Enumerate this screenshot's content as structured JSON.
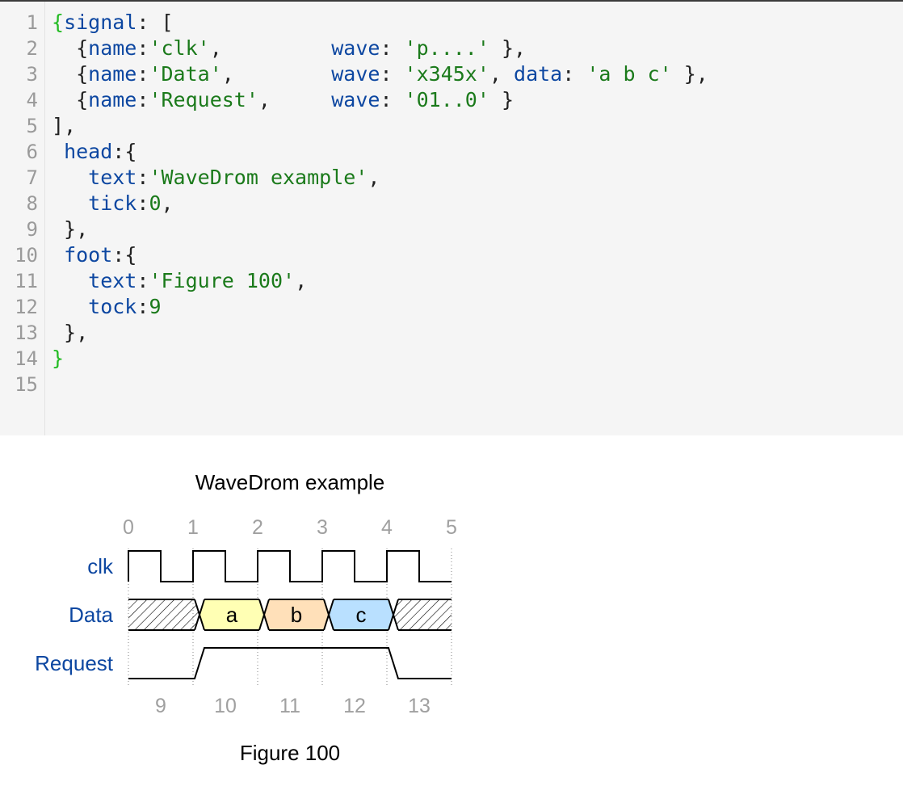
{
  "editor": {
    "colors": {
      "property": "#0d47a1",
      "string": "#1b7a1b",
      "number": "#1b7a1b",
      "bracket_match": "#22bb22",
      "punct": "#222222",
      "gutter": "#9a9a9a"
    },
    "lines": [
      {
        "n": "1",
        "tokens": [
          {
            "t": "{",
            "c": "bracket_match"
          },
          {
            "t": "signal",
            "c": "property"
          },
          {
            "t": ": [",
            "c": "punct"
          }
        ]
      },
      {
        "n": "2",
        "tokens": [
          {
            "t": "  {",
            "c": "punct"
          },
          {
            "t": "name",
            "c": "property"
          },
          {
            "t": ":",
            "c": "punct"
          },
          {
            "t": "'clk'",
            "c": "string"
          },
          {
            "t": ",         ",
            "c": "punct"
          },
          {
            "t": "wave",
            "c": "property"
          },
          {
            "t": ": ",
            "c": "punct"
          },
          {
            "t": "'p....'",
            "c": "string"
          },
          {
            "t": " },",
            "c": "punct"
          }
        ]
      },
      {
        "n": "3",
        "tokens": [
          {
            "t": "  {",
            "c": "punct"
          },
          {
            "t": "name",
            "c": "property"
          },
          {
            "t": ":",
            "c": "punct"
          },
          {
            "t": "'Data'",
            "c": "string"
          },
          {
            "t": ",        ",
            "c": "punct"
          },
          {
            "t": "wave",
            "c": "property"
          },
          {
            "t": ": ",
            "c": "punct"
          },
          {
            "t": "'x345x'",
            "c": "string"
          },
          {
            "t": ", ",
            "c": "punct"
          },
          {
            "t": "data",
            "c": "property"
          },
          {
            "t": ": ",
            "c": "punct"
          },
          {
            "t": "'a b c'",
            "c": "string"
          },
          {
            "t": " },",
            "c": "punct"
          }
        ]
      },
      {
        "n": "4",
        "tokens": [
          {
            "t": "  {",
            "c": "punct"
          },
          {
            "t": "name",
            "c": "property"
          },
          {
            "t": ":",
            "c": "punct"
          },
          {
            "t": "'Request'",
            "c": "string"
          },
          {
            "t": ",     ",
            "c": "punct"
          },
          {
            "t": "wave",
            "c": "property"
          },
          {
            "t": ": ",
            "c": "punct"
          },
          {
            "t": "'01..0'",
            "c": "string"
          },
          {
            "t": " }",
            "c": "punct"
          }
        ]
      },
      {
        "n": "5",
        "tokens": [
          {
            "t": "],",
            "c": "punct"
          }
        ]
      },
      {
        "n": "6",
        "tokens": [
          {
            "t": " ",
            "c": "punct"
          },
          {
            "t": "head",
            "c": "property"
          },
          {
            "t": ":{",
            "c": "punct"
          }
        ]
      },
      {
        "n": "7",
        "tokens": [
          {
            "t": "   ",
            "c": "punct"
          },
          {
            "t": "text",
            "c": "property"
          },
          {
            "t": ":",
            "c": "punct"
          },
          {
            "t": "'WaveDrom example'",
            "c": "string"
          },
          {
            "t": ",",
            "c": "punct"
          }
        ]
      },
      {
        "n": "8",
        "tokens": [
          {
            "t": "   ",
            "c": "punct"
          },
          {
            "t": "tick",
            "c": "property"
          },
          {
            "t": ":",
            "c": "punct"
          },
          {
            "t": "0",
            "c": "number"
          },
          {
            "t": ",",
            "c": "punct"
          }
        ]
      },
      {
        "n": "9",
        "tokens": [
          {
            "t": " },",
            "c": "punct"
          }
        ]
      },
      {
        "n": "10",
        "tokens": [
          {
            "t": " ",
            "c": "punct"
          },
          {
            "t": "foot",
            "c": "property"
          },
          {
            "t": ":{",
            "c": "punct"
          }
        ]
      },
      {
        "n": "11",
        "tokens": [
          {
            "t": "   ",
            "c": "punct"
          },
          {
            "t": "text",
            "c": "property"
          },
          {
            "t": ":",
            "c": "punct"
          },
          {
            "t": "'Figure 100'",
            "c": "string"
          },
          {
            "t": ",",
            "c": "punct"
          }
        ]
      },
      {
        "n": "12",
        "tokens": [
          {
            "t": "   ",
            "c": "punct"
          },
          {
            "t": "tock",
            "c": "property"
          },
          {
            "t": ":",
            "c": "punct"
          },
          {
            "t": "9",
            "c": "number"
          }
        ]
      },
      {
        "n": "13",
        "tokens": [
          {
            "t": " },",
            "c": "punct"
          }
        ]
      },
      {
        "n": "14",
        "tokens": [
          {
            "t": "}",
            "c": "bracket_match"
          }
        ]
      },
      {
        "n": "15",
        "tokens": []
      }
    ]
  },
  "waveform": {
    "title": "WaveDrom example",
    "footer": "Figure 100",
    "head_ticks": [
      "0",
      "1",
      "2",
      "3",
      "4",
      "5"
    ],
    "foot_tocks": [
      "9",
      "10",
      "11",
      "12",
      "13"
    ],
    "colors": {
      "signal_name": "#0d47a1",
      "tick": "#a0a0a0",
      "line": "#000000",
      "slot_a": "#ffffb4",
      "slot_b": "#ffe0b9",
      "slot_c": "#b9e0ff"
    },
    "signals": [
      {
        "name": "clk",
        "wave": "p...."
      },
      {
        "name": "Data",
        "wave": "x345x",
        "data": [
          "a",
          "b",
          "c"
        ]
      },
      {
        "name": "Request",
        "wave": "01..0"
      }
    ]
  }
}
